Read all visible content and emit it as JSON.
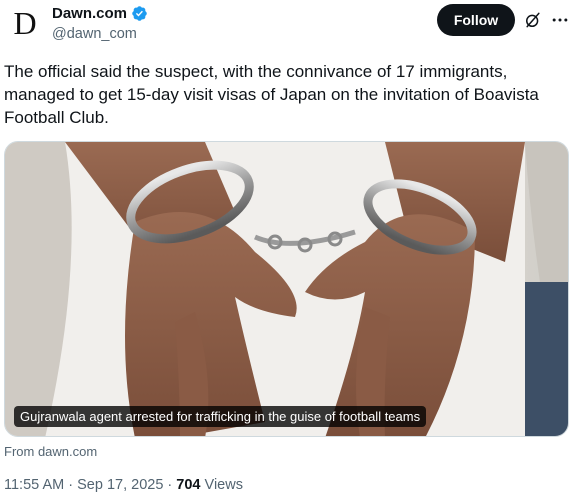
{
  "account": {
    "avatar_letter": "D",
    "display_name": "Dawn.com",
    "handle": "@dawn_com",
    "verified": true,
    "verified_color": "#1d9bf0"
  },
  "actions": {
    "follow_label": "Follow",
    "grok_icon": "grok-icon",
    "more_icon": "more-dots-icon"
  },
  "tweet": {
    "text": "The official said the suspect, with the connivance of 17 immigrants, managed to get 15-day visit visas of Japan on the invitation of Boavista Football Club."
  },
  "card": {
    "image_description": "handcuffed-hands-photo",
    "caption": "Gujranwala agent arrested for trafficking in the guise of football teams",
    "source": "From dawn.com"
  },
  "meta": {
    "time": "11:55 AM",
    "separator": "·",
    "date": "Sep 17, 2025",
    "views_count": "704",
    "views_label": "Views"
  }
}
